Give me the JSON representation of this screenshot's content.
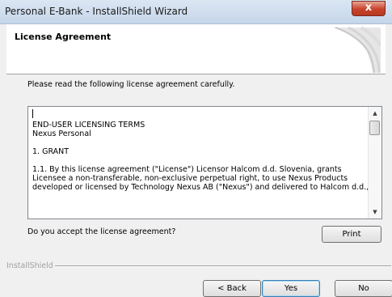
{
  "window": {
    "title": "Personal E-Bank - InstallShield Wizard",
    "close_glyph": "x"
  },
  "header": {
    "title": "License Agreement"
  },
  "instruction": "Please read the following license agreement carefully.",
  "license": {
    "lines": [
      "END-USER LICENSING TERMS",
      "Nexus Personal",
      "",
      "1. GRANT",
      "",
      "1.1. By this license agreement (\"License\") Licensor Halcom d.d. Slovenia, grants",
      "Licensee a non-transferable, non-exclusive perpetual right, to use Nexus Products",
      "developed or licensed by Technology Nexus AB (\"Nexus\") and delivered to Halcom d.d.,"
    ],
    "scroll_up_glyph": "▲",
    "scroll_down_glyph": "▼"
  },
  "question": "Do you accept the license agreement?",
  "buttons": {
    "print": "Print",
    "back": "< Back",
    "yes": "Yes",
    "no": "No"
  },
  "footer": {
    "brand": "InstallShield"
  },
  "colors": {
    "title_bar": "#c5d6ea",
    "close_button": "#c7422a",
    "default_button_border": "#3c7fb1"
  }
}
